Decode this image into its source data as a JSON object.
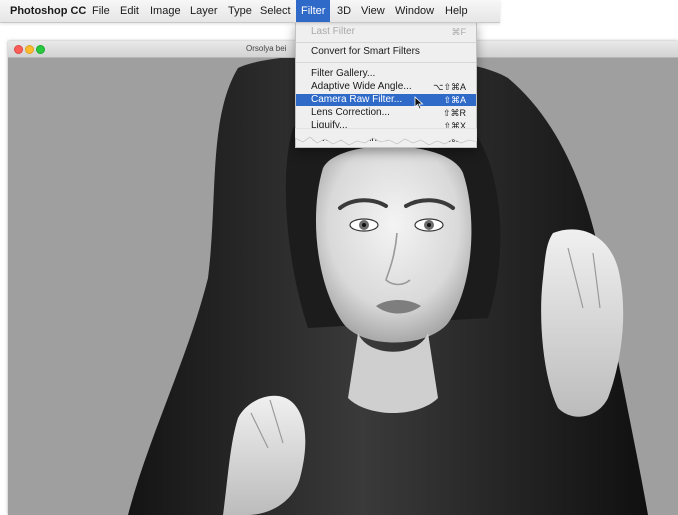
{
  "menubar": {
    "app_name": "Photoshop CC",
    "menus": [
      "File",
      "Edit",
      "Image",
      "Layer",
      "Type",
      "Select",
      "Filter",
      "3D",
      "View",
      "Window",
      "Help"
    ],
    "active_menu": "Filter"
  },
  "window": {
    "title": "Orsolya bei",
    "traffic_lights": [
      "close",
      "minimize",
      "zoom"
    ]
  },
  "filter_menu": {
    "last_filter": {
      "label": "Last Filter",
      "shortcut": "⌘F",
      "enabled": false
    },
    "convert": {
      "label": "Convert for Smart Filters"
    },
    "items": [
      {
        "label": "Filter Gallery...",
        "shortcut": ""
      },
      {
        "label": "Adaptive Wide Angle...",
        "shortcut": "⌥⇧⌘A"
      },
      {
        "label": "Camera Raw Filter...",
        "shortcut": "⇧⌘A",
        "highlighted": true
      },
      {
        "label": "Lens Correction...",
        "shortcut": "⇧⌘R"
      },
      {
        "label": "Liquify...",
        "shortcut": "⇧⌘X"
      },
      {
        "label": "Vanishing Point...",
        "shortcut": "⌥⌘V"
      }
    ]
  },
  "canvas": {
    "image_alt": "Black and white portrait of a woman wearing a dark hooded scarf, hands holding the hood",
    "background_color": "#9f9f9f"
  },
  "colors": {
    "highlight": "#2f6ac9",
    "menu_bg": "#efefef",
    "canvas_bg": "#9f9f9f"
  }
}
